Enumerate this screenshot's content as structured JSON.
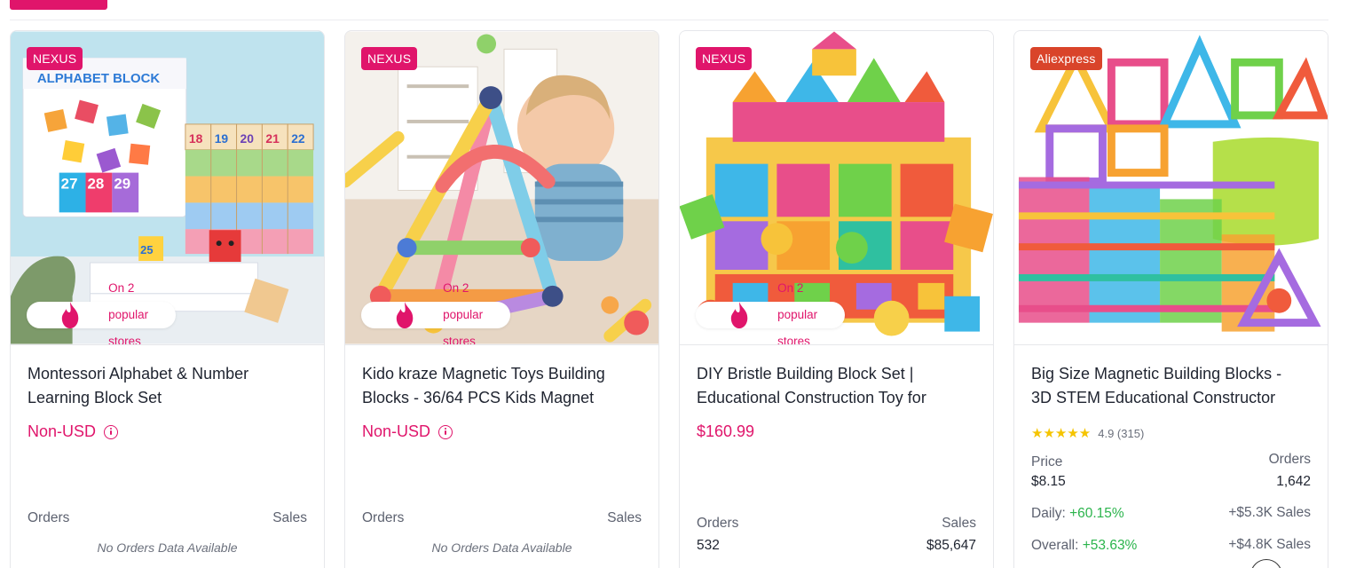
{
  "cards": [
    {
      "badge": "NEXUS",
      "stores": "On 2 popular stores",
      "title_line1": "Montessori Alphabet & Number",
      "title_line2": "Learning Block Set",
      "price": "Non-USD",
      "orders_label": "Orders",
      "sales_label": "Sales",
      "no_data": "No Orders Data Available",
      "box_label": "ALPHABET BLOCK",
      "block_numbers": [
        "18",
        "19",
        "20",
        "21",
        "22",
        "27",
        "28",
        "29",
        "25"
      ]
    },
    {
      "badge": "NEXUS",
      "stores": "On 2 popular stores",
      "title_line1": "Kido kraze Magnetic Toys Building",
      "title_line2": "Blocks - 36/64 PCS Kids Magnet",
      "price": "Non-USD",
      "orders_label": "Orders",
      "sales_label": "Sales",
      "no_data": "No Orders Data Available"
    },
    {
      "badge": "NEXUS",
      "stores": "On 2 popular stores",
      "title_line1": "DIY Bristle Building Block Set |",
      "title_line2": "Educational Construction Toy for",
      "price": "$160.99",
      "orders_label": "Orders",
      "sales_label": "Sales",
      "orders_value": "532",
      "sales_value": "$85,647"
    },
    {
      "badge": "Aliexpress",
      "title_line1": "Big Size Magnetic Building Blocks -",
      "title_line2": "3D STEM Educational Constructor",
      "stars": "★★★★★",
      "rating": "4.9 (315)",
      "price_label": "Price",
      "price_value": "$8.15",
      "orders_label": "Orders",
      "orders_value": "1,642",
      "daily_label": "Daily:",
      "daily_change": "+60.15%",
      "daily_sales": "+$5.3K Sales",
      "overall_label": "Overall:",
      "overall_change": "+53.63%",
      "overall_sales": "+$4.8K Sales"
    }
  ],
  "colors": {
    "accent": "#e0156b",
    "aliexpress": "#d9442a",
    "positive": "#2bb44c",
    "star": "#f5c400"
  }
}
